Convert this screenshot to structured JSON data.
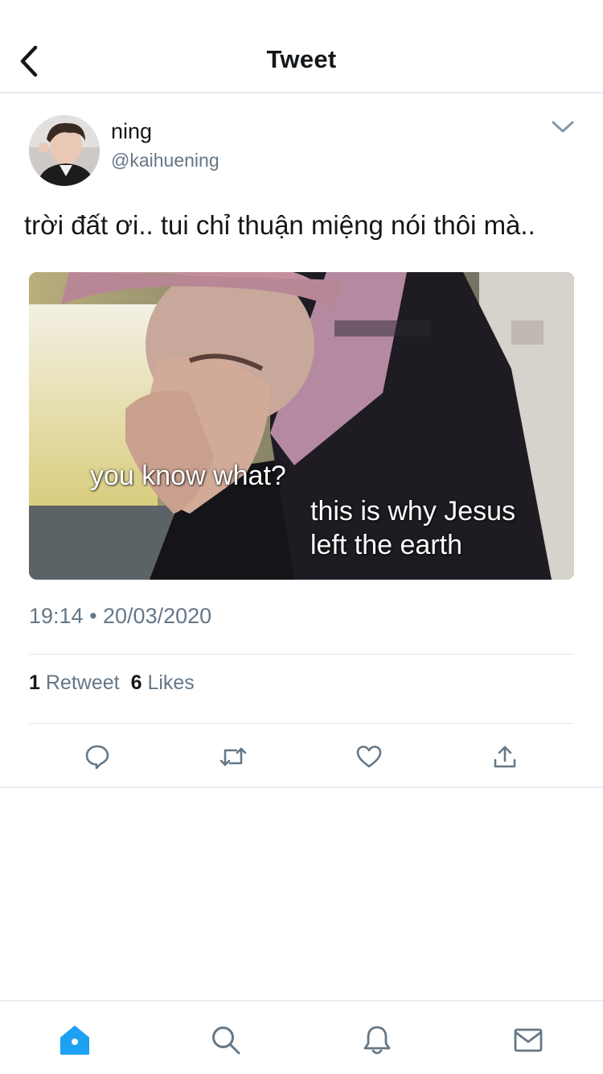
{
  "header": {
    "back_icon": "chevron-left-icon",
    "title": "Tweet"
  },
  "tweet": {
    "author": {
      "name": "ning",
      "handle": "@kaihuening",
      "avatar_icon": "avatar"
    },
    "more_icon": "chevron-down-icon",
    "text": "trời đất ơi.. tui chỉ thuận miệng nói thôi mà..",
    "media": {
      "caption_top": "you know what?",
      "caption_bottom_line1": "this is why Jesus",
      "caption_bottom_line2": "left the earth"
    },
    "timestamp": "19:14 • 20/03/2020",
    "stats": {
      "retweets_count": "1",
      "retweets_label": "Retweet",
      "likes_count": "6",
      "likes_label": "Likes"
    }
  },
  "actions": [
    {
      "icon": "reply-icon"
    },
    {
      "icon": "retweet-icon"
    },
    {
      "icon": "like-icon"
    },
    {
      "icon": "share-icon"
    }
  ],
  "tabbar": {
    "items": [
      {
        "icon": "home-icon",
        "active": true
      },
      {
        "icon": "search-icon",
        "active": false
      },
      {
        "icon": "notifications-icon",
        "active": false
      },
      {
        "icon": "messages-icon",
        "active": false
      }
    ]
  },
  "colors": {
    "accent": "#1da1f2",
    "text_primary": "#14171a",
    "text_secondary": "#657786",
    "divider": "#e6ecf0"
  }
}
